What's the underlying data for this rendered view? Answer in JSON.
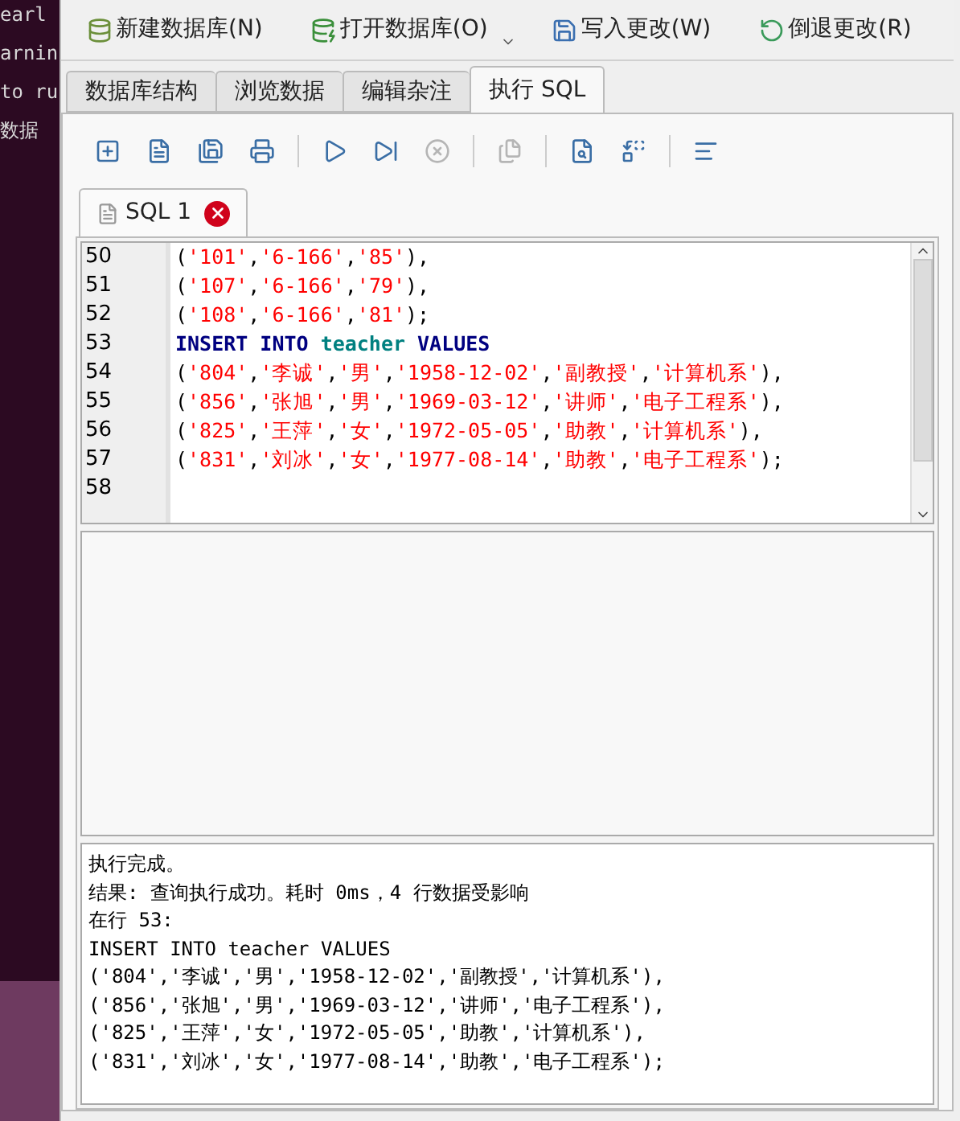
{
  "terminal_lines": [
    "earl",
    "arnin",
    "to ru",
    "数据"
  ],
  "toolbar": [
    {
      "label": "新建数据库(N)",
      "dropdown": false
    },
    {
      "label": "打开数据库(O)",
      "dropdown": true
    },
    {
      "label": "写入更改(W)",
      "dropdown": false
    },
    {
      "label": "倒退更改(R)",
      "dropdown": false
    }
  ],
  "tabs": [
    {
      "label": "数据库结构",
      "selected": false
    },
    {
      "label": "浏览数据",
      "selected": false
    },
    {
      "label": "编辑杂注",
      "selected": false
    },
    {
      "label": "执行 SQL",
      "selected": true
    }
  ],
  "sql_toolbar": [
    {
      "kind": "button",
      "disabled": false
    },
    {
      "kind": "button",
      "disabled": false
    },
    {
      "kind": "button",
      "disabled": false
    },
    {
      "kind": "button",
      "disabled": false
    },
    {
      "kind": "separator"
    },
    {
      "kind": "button",
      "disabled": false
    },
    {
      "kind": "button",
      "disabled": false
    },
    {
      "kind": "button",
      "disabled": true
    },
    {
      "kind": "separator"
    },
    {
      "kind": "button",
      "disabled": true
    },
    {
      "kind": "separator"
    },
    {
      "kind": "button",
      "disabled": false
    },
    {
      "kind": "button",
      "disabled": false
    },
    {
      "kind": "separator"
    },
    {
      "kind": "button",
      "disabled": false
    }
  ],
  "editor_tab": {
    "label": "SQL 1"
  },
  "editor_lines": [
    {
      "number": "50",
      "tokens": [
        {
          "kind": "punct",
          "text": "("
        },
        {
          "kind": "string",
          "text": "'101'"
        },
        {
          "kind": "punct",
          "text": ","
        },
        {
          "kind": "string",
          "text": "'6-166'"
        },
        {
          "kind": "punct",
          "text": ","
        },
        {
          "kind": "string",
          "text": "'85'"
        },
        {
          "kind": "punct",
          "text": "),"
        }
      ]
    },
    {
      "number": "51",
      "tokens": [
        {
          "kind": "punct",
          "text": "("
        },
        {
          "kind": "string",
          "text": "'107'"
        },
        {
          "kind": "punct",
          "text": ","
        },
        {
          "kind": "string",
          "text": "'6-166'"
        },
        {
          "kind": "punct",
          "text": ","
        },
        {
          "kind": "string",
          "text": "'79'"
        },
        {
          "kind": "punct",
          "text": "),"
        }
      ]
    },
    {
      "number": "52",
      "tokens": [
        {
          "kind": "punct",
          "text": "("
        },
        {
          "kind": "string",
          "text": "'108'"
        },
        {
          "kind": "punct",
          "text": ","
        },
        {
          "kind": "string",
          "text": "'6-166'"
        },
        {
          "kind": "punct",
          "text": ","
        },
        {
          "kind": "string",
          "text": "'81'"
        },
        {
          "kind": "punct",
          "text": ");"
        }
      ]
    },
    {
      "number": "53",
      "tokens": [
        {
          "kind": "keyword",
          "text": "INSERT INTO "
        },
        {
          "kind": "identifier",
          "text": "teacher "
        },
        {
          "kind": "keyword",
          "text": "VALUES"
        }
      ]
    },
    {
      "number": "54",
      "tokens": [
        {
          "kind": "punct",
          "text": "("
        },
        {
          "kind": "string",
          "text": "'804'"
        },
        {
          "kind": "punct",
          "text": ","
        },
        {
          "kind": "string",
          "text": "'李诚'"
        },
        {
          "kind": "punct",
          "text": ","
        },
        {
          "kind": "string",
          "text": "'男'"
        },
        {
          "kind": "punct",
          "text": ","
        },
        {
          "kind": "string",
          "text": "'1958-12-02'"
        },
        {
          "kind": "punct",
          "text": ","
        },
        {
          "kind": "string",
          "text": "'副教授'"
        },
        {
          "kind": "punct",
          "text": ","
        },
        {
          "kind": "string",
          "text": "'计算机系'"
        },
        {
          "kind": "punct",
          "text": "),"
        }
      ]
    },
    {
      "number": "55",
      "tokens": [
        {
          "kind": "punct",
          "text": "("
        },
        {
          "kind": "string",
          "text": "'856'"
        },
        {
          "kind": "punct",
          "text": ","
        },
        {
          "kind": "string",
          "text": "'张旭'"
        },
        {
          "kind": "punct",
          "text": ","
        },
        {
          "kind": "string",
          "text": "'男'"
        },
        {
          "kind": "punct",
          "text": ","
        },
        {
          "kind": "string",
          "text": "'1969-03-12'"
        },
        {
          "kind": "punct",
          "text": ","
        },
        {
          "kind": "string",
          "text": "'讲师'"
        },
        {
          "kind": "punct",
          "text": ","
        },
        {
          "kind": "string",
          "text": "'电子工程系'"
        },
        {
          "kind": "punct",
          "text": "),"
        }
      ]
    },
    {
      "number": "56",
      "tokens": [
        {
          "kind": "punct",
          "text": "("
        },
        {
          "kind": "string",
          "text": "'825'"
        },
        {
          "kind": "punct",
          "text": ","
        },
        {
          "kind": "string",
          "text": "'王萍'"
        },
        {
          "kind": "punct",
          "text": ","
        },
        {
          "kind": "string",
          "text": "'女'"
        },
        {
          "kind": "punct",
          "text": ","
        },
        {
          "kind": "string",
          "text": "'1972-05-05'"
        },
        {
          "kind": "punct",
          "text": ","
        },
        {
          "kind": "string",
          "text": "'助教'"
        },
        {
          "kind": "punct",
          "text": ","
        },
        {
          "kind": "string",
          "text": "'计算机系'"
        },
        {
          "kind": "punct",
          "text": "),"
        }
      ]
    },
    {
      "number": "57",
      "tokens": [
        {
          "kind": "punct",
          "text": "("
        },
        {
          "kind": "string",
          "text": "'831'"
        },
        {
          "kind": "punct",
          "text": ","
        },
        {
          "kind": "string",
          "text": "'刘冰'"
        },
        {
          "kind": "punct",
          "text": ","
        },
        {
          "kind": "string",
          "text": "'女'"
        },
        {
          "kind": "punct",
          "text": ","
        },
        {
          "kind": "string",
          "text": "'1977-08-14'"
        },
        {
          "kind": "punct",
          "text": ","
        },
        {
          "kind": "string",
          "text": "'助教'"
        },
        {
          "kind": "punct",
          "text": ","
        },
        {
          "kind": "string",
          "text": "'电子工程系'"
        },
        {
          "kind": "punct",
          "text": ");"
        }
      ]
    },
    {
      "number": "58"
    }
  ],
  "message_lines": [
    "执行完成。",
    "结果: 查询执行成功。耗时 0ms，4 行数据受影响",
    "在行 53:",
    "INSERT INTO teacher VALUES",
    "('804','李诚','男','1958-12-02','副教授','计算机系'),",
    "('856','张旭','男','1969-03-12','讲师','电子工程系'),",
    "('825','王萍','女','1972-05-05','助教','计算机系'),",
    "('831','刘冰','女','1977-08-14','助教','电子工程系');"
  ]
}
